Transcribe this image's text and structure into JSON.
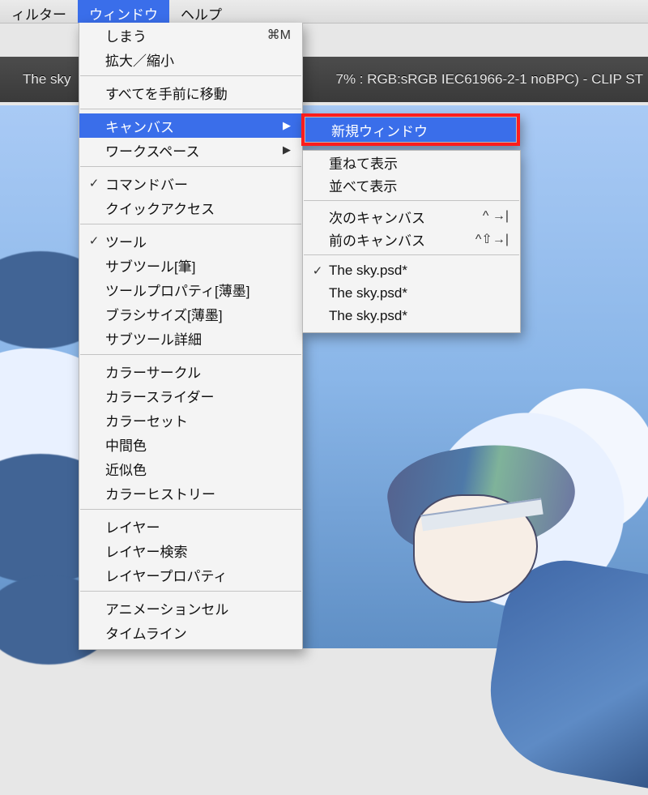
{
  "menubar": {
    "filter": "ィルター",
    "window": "ウィンドウ",
    "help": "ヘルプ"
  },
  "titlebar": {
    "left": "The sky",
    "right": "7% : RGB:sRGB IEC61966-2-1 noBPC)  - CLIP ST"
  },
  "menu": {
    "close": {
      "label": "しまう",
      "accel": "⌘M"
    },
    "zoom": {
      "label": "拡大／縮小"
    },
    "bring_front": {
      "label": "すべてを手前に移動"
    },
    "canvas": {
      "label": "キャンバス"
    },
    "workspace": {
      "label": "ワークスペース"
    },
    "cmdbar": {
      "label": "コマンドバー"
    },
    "quickaccess": {
      "label": "クイックアクセス"
    },
    "tool": {
      "label": "ツール"
    },
    "subtool_brush": {
      "label": "サブツール[筆]"
    },
    "toolprop": {
      "label": "ツールプロパティ[薄墨]"
    },
    "brushsize": {
      "label": "ブラシサイズ[薄墨]"
    },
    "subtool_detail": {
      "label": "サブツール詳細"
    },
    "colorcircle": {
      "label": "カラーサークル"
    },
    "colorslider": {
      "label": "カラースライダー"
    },
    "colorset": {
      "label": "カラーセット"
    },
    "midcolor": {
      "label": "中間色"
    },
    "approxcolor": {
      "label": "近似色"
    },
    "colorhistory": {
      "label": "カラーヒストリー"
    },
    "layer": {
      "label": "レイヤー"
    },
    "layersearch": {
      "label": "レイヤー検索"
    },
    "layerprop": {
      "label": "レイヤープロパティ"
    },
    "animcel": {
      "label": "アニメーションセル"
    },
    "timeline": {
      "label": "タイムライン"
    }
  },
  "submenu": {
    "new_window": {
      "label": "新規ウィンドウ"
    },
    "cascade": {
      "label": "重ねて表示"
    },
    "tile": {
      "label": "並べて表示"
    },
    "next_canvas": {
      "label": "次のキャンバス",
      "accel": "^ →|"
    },
    "prev_canvas": {
      "label": "前のキャンバス",
      "accel": "^⇧→|"
    },
    "doc1": {
      "label": "The sky.psd*"
    },
    "doc2": {
      "label": "The sky.psd*"
    },
    "doc3": {
      "label": "The sky.psd*"
    }
  }
}
